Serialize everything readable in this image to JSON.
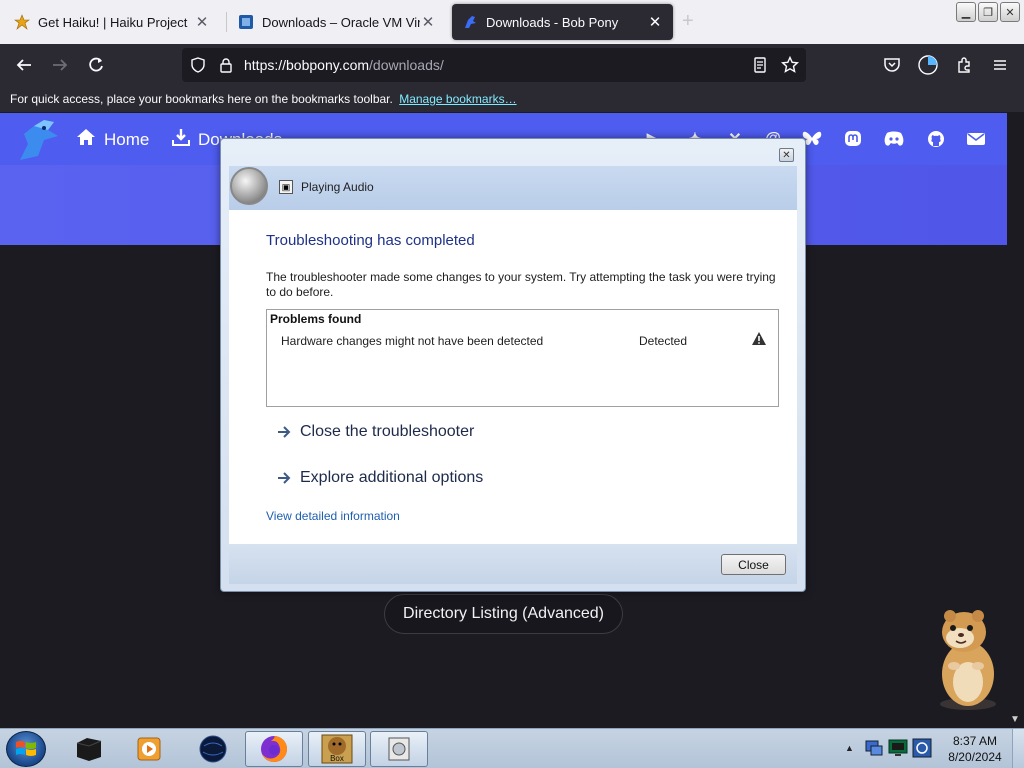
{
  "browser": {
    "tabs": [
      {
        "title": "Get Haiku! | Haiku Project",
        "favicon": "haiku-leaf-icon",
        "active": false
      },
      {
        "title": "Downloads – Oracle VM VirtualBox",
        "favicon": "virtualbox-icon",
        "active": false
      },
      {
        "title": "Downloads - Bob Pony",
        "favicon": "bobpony-icon",
        "active": true
      }
    ],
    "url_host": "https://bobpony.com",
    "url_path": "/downloads/",
    "bookmarks_bar": {
      "message": "For quick access, place your bookmarks here on the bookmarks toolbar.",
      "link": "Manage bookmarks…"
    }
  },
  "website": {
    "nav": [
      {
        "label": "Home",
        "icon": "home-icon"
      },
      {
        "label": "Downloads",
        "icon": "download-icon"
      }
    ],
    "social_icons": [
      "youtube-icon",
      "twitter-icon",
      "x-icon",
      "threads-icon",
      "bluesky-icon",
      "mastodon-icon",
      "discord-icon",
      "github-icon",
      "email-icon"
    ],
    "directory_button": "Directory Listing (Advanced)",
    "header_color": "#4e5cf0"
  },
  "dialog": {
    "app_title": "Playing Audio",
    "heading": "Troubleshooting has completed",
    "description": "The troubleshooter made some changes to your system. Try attempting the task you were trying to do before.",
    "problems_header": "Problems found",
    "problems": [
      {
        "name": "Hardware changes might not have been detected",
        "status": "Detected",
        "icon": "warning-icon"
      }
    ],
    "options": [
      "Close the troubleshooter",
      "Explore additional options"
    ],
    "detail_link": "View detailed information",
    "close_button": "Close"
  },
  "taskbar": {
    "clock_time": "8:37 AM",
    "clock_date": "8/20/2024",
    "items": [
      "black-box-app-icon",
      "media-player-icon",
      "dark-globe-icon",
      "firefox-icon",
      "box-game-icon",
      "troubleshooter-icon"
    ]
  }
}
